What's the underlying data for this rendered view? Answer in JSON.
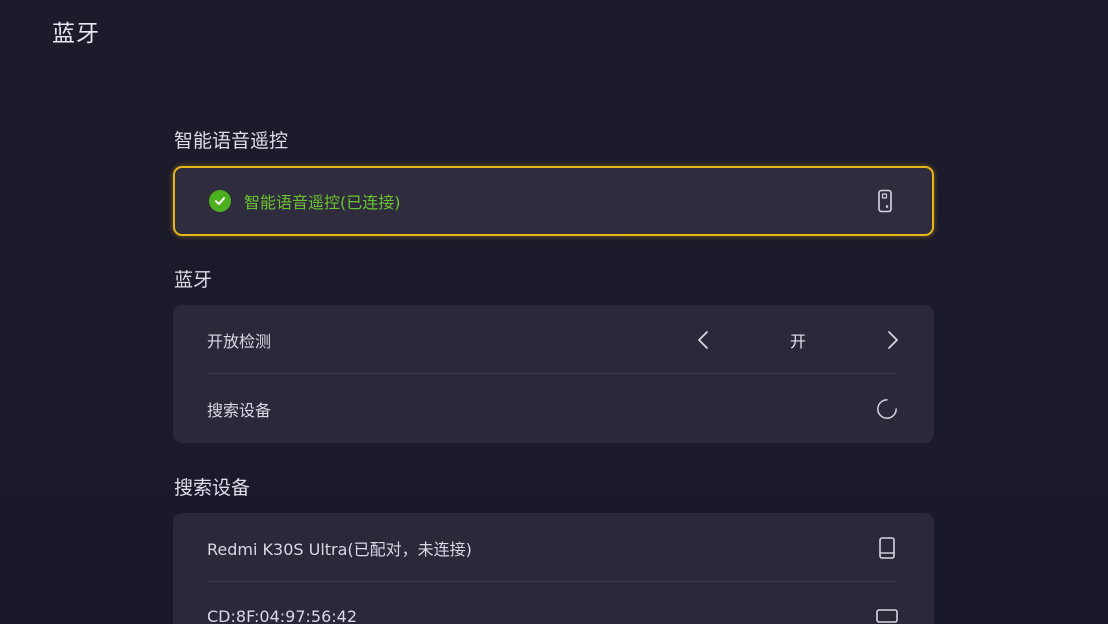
{
  "page": {
    "title": "蓝牙"
  },
  "voice_remote": {
    "section_title": "智能语音遥控",
    "device_label": "智能语音遥控(已连接)",
    "status_icon": "check-icon",
    "device_icon": "remote-icon",
    "status_color": "#4caf1e"
  },
  "bluetooth": {
    "section_title": "蓝牙",
    "discoverable": {
      "label": "开放检测",
      "value": "开"
    },
    "search": {
      "label": "搜索设备",
      "icon": "loading-spinner-icon"
    }
  },
  "search_devices": {
    "section_title": "搜索设备",
    "devices": [
      {
        "label": "Redmi K30S Ultra(已配对，未连接)",
        "icon": "phone-icon"
      },
      {
        "label": "CD:8F:04:97:56:42",
        "icon": "monitor-icon"
      }
    ]
  },
  "colors": {
    "focus_border": "#e8b518",
    "background": "#1b1a2a",
    "card": "#2a2839"
  }
}
